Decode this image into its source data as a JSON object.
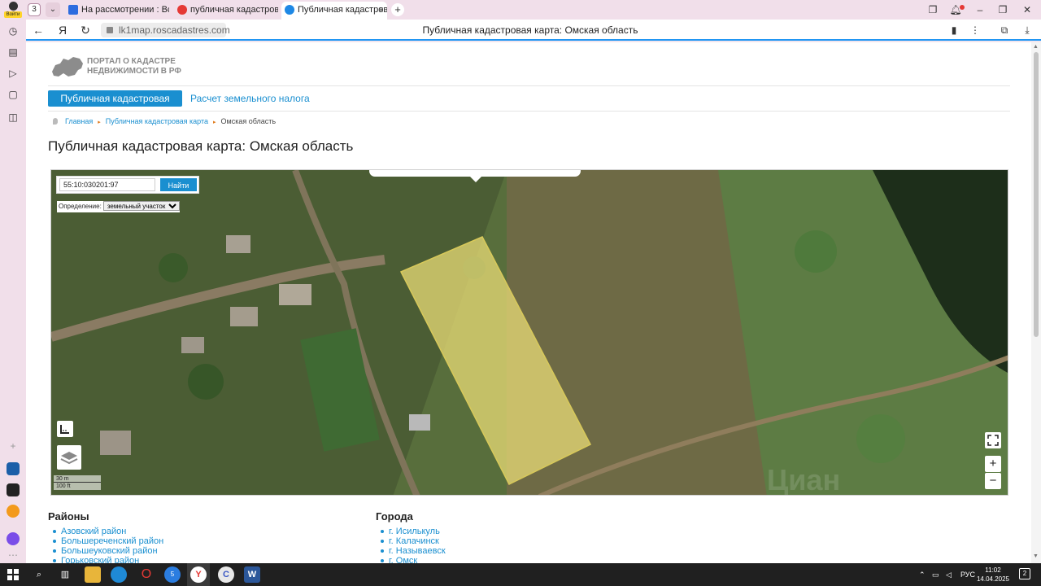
{
  "browser": {
    "profile_badge": "Войти",
    "tab_count": "3",
    "tabs": [
      {
        "title": "На рассмотрении : Все д"
      },
      {
        "title": "публичная кадастровая"
      },
      {
        "title": "Публичная кадастрова"
      }
    ],
    "url": "lk1map.roscadastres.com",
    "page_title": "Публичная кадастровая карта: Омская область"
  },
  "site": {
    "logo_line1": "ПОРТАЛ О КАДАСТРЕ",
    "logo_line2": "НЕДВИЖИМОСТИ В РФ",
    "menu": {
      "active": "Публичная кадастровая карта",
      "link": "Расчет земельного налога"
    },
    "breadcrumb": [
      "Главная",
      "Публичная кадастровая карта",
      "Омская область"
    ],
    "heading": "Публичная кадастровая карта: Омская область"
  },
  "map": {
    "search_value": "55:10:030201:97",
    "search_button": "Найти",
    "definition_label": "Определение:",
    "definition_selected": "земельный участок",
    "scale_metric": "30 m",
    "scale_imperial": "100 ft",
    "zoom_in": "+",
    "zoom_out": "−",
    "watermark": "Циан"
  },
  "districts": {
    "title": "Районы",
    "items": [
      "Азовский район",
      "Большереченский район",
      "Большеуковский район",
      "Горьковский район"
    ]
  },
  "cities": {
    "title": "Города",
    "items": [
      "г. Исилькуль",
      "г. Калачинск",
      "г. Называевск",
      "г. Омск"
    ]
  },
  "taskbar": {
    "language": "РУС",
    "time": "11:02",
    "date": "14.04.2025",
    "notifications": "2",
    "browser_badge": "5"
  }
}
